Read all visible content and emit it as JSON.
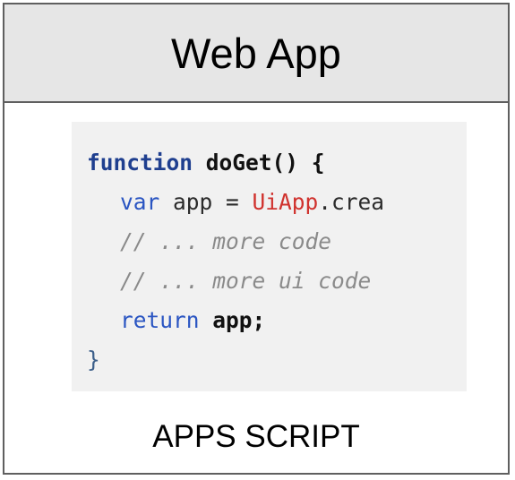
{
  "header": {
    "title": "Web App"
  },
  "code": {
    "line1": {
      "keyword": "function",
      "name": "doGet() {"
    },
    "line2": {
      "keyword": "var",
      "text1": " app = ",
      "class_name": "UiApp",
      "text2": ".crea"
    },
    "line3": {
      "comment": "// ... more code"
    },
    "line4": {
      "comment": "// ... more ui code"
    },
    "line5": {
      "keyword": "return",
      "text": " ",
      "value": "app;"
    },
    "line6": {
      "brace": "}"
    }
  },
  "footer": {
    "label": "APPS SCRIPT"
  },
  "colors": {
    "header_bg": "#e6e6e6",
    "border": "#5f5f5f",
    "code_bg": "#f1f1f1",
    "keyword": "#2a55c2",
    "class_name": "#d0322e",
    "comment": "#8a8a8a"
  }
}
